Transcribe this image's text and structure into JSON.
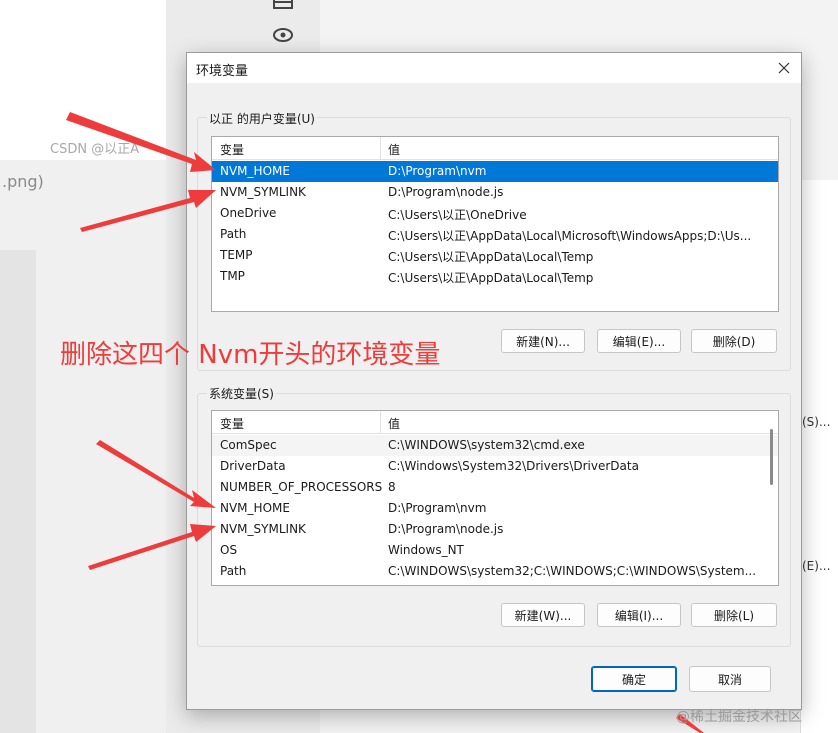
{
  "background": {
    "filename_fragment": ".png)",
    "watermark_top": "CSDN @以正A",
    "watermark_bottom": "@稀土掘金技术社区",
    "right_buttons": [
      "(S)...",
      "(E)..."
    ]
  },
  "dialog": {
    "title": "环境变量",
    "user_vars": {
      "group_label": "以正 的用户变量(U)",
      "col_name": "变量",
      "col_value": "值",
      "rows": [
        {
          "name": "NVM_HOME",
          "value": "D:\\Program\\nvm"
        },
        {
          "name": "NVM_SYMLINK",
          "value": "D:\\Program\\node.js"
        },
        {
          "name": "OneDrive",
          "value": "C:\\Users\\以正\\OneDrive"
        },
        {
          "name": "Path",
          "value": "C:\\Users\\以正\\AppData\\Local\\Microsoft\\WindowsApps;D:\\Us..."
        },
        {
          "name": "TEMP",
          "value": "C:\\Users\\以正\\AppData\\Local\\Temp"
        },
        {
          "name": "TMP",
          "value": "C:\\Users\\以正\\AppData\\Local\\Temp"
        }
      ],
      "new_label": "新建(N)...",
      "edit_label": "编辑(E)...",
      "delete_label": "删除(D)"
    },
    "system_vars": {
      "group_label": "系统变量(S)",
      "col_name": "变量",
      "col_value": "值",
      "rows": [
        {
          "name": "ComSpec",
          "value": "C:\\WINDOWS\\system32\\cmd.exe"
        },
        {
          "name": "DriverData",
          "value": "C:\\Windows\\System32\\Drivers\\DriverData"
        },
        {
          "name": "NUMBER_OF_PROCESSORS",
          "value": "8"
        },
        {
          "name": "NVM_HOME",
          "value": "D:\\Program\\nvm"
        },
        {
          "name": "NVM_SYMLINK",
          "value": "D:\\Program\\node.js"
        },
        {
          "name": "OS",
          "value": "Windows_NT"
        },
        {
          "name": "Path",
          "value": "C:\\WINDOWS\\system32;C:\\WINDOWS;C:\\WINDOWS\\System..."
        }
      ],
      "new_label": "新建(W)...",
      "edit_label": "编辑(I)...",
      "delete_label": "删除(L)"
    },
    "ok_label": "确定",
    "cancel_label": "取消"
  },
  "annotation": {
    "text": "删除这四个 Nvm开头的环境变量",
    "color": "#ee3b3b"
  },
  "colors": {
    "selection": "#0078d7",
    "primary_border": "#0067c0"
  }
}
